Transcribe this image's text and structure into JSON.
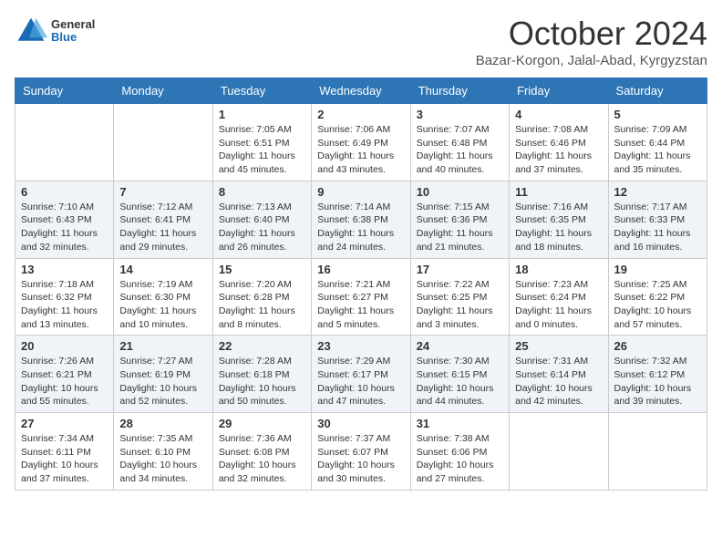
{
  "header": {
    "logo": {
      "general": "General",
      "blue": "Blue"
    },
    "title": "October 2024",
    "subtitle": "Bazar-Korgon, Jalal-Abad, Kyrgyzstan"
  },
  "weekdays": [
    "Sunday",
    "Monday",
    "Tuesday",
    "Wednesday",
    "Thursday",
    "Friday",
    "Saturday"
  ],
  "weeks": [
    [
      {
        "day": "",
        "info": ""
      },
      {
        "day": "",
        "info": ""
      },
      {
        "day": "1",
        "info": "Sunrise: 7:05 AM\nSunset: 6:51 PM\nDaylight: 11 hours and 45 minutes."
      },
      {
        "day": "2",
        "info": "Sunrise: 7:06 AM\nSunset: 6:49 PM\nDaylight: 11 hours and 43 minutes."
      },
      {
        "day": "3",
        "info": "Sunrise: 7:07 AM\nSunset: 6:48 PM\nDaylight: 11 hours and 40 minutes."
      },
      {
        "day": "4",
        "info": "Sunrise: 7:08 AM\nSunset: 6:46 PM\nDaylight: 11 hours and 37 minutes."
      },
      {
        "day": "5",
        "info": "Sunrise: 7:09 AM\nSunset: 6:44 PM\nDaylight: 11 hours and 35 minutes."
      }
    ],
    [
      {
        "day": "6",
        "info": "Sunrise: 7:10 AM\nSunset: 6:43 PM\nDaylight: 11 hours and 32 minutes."
      },
      {
        "day": "7",
        "info": "Sunrise: 7:12 AM\nSunset: 6:41 PM\nDaylight: 11 hours and 29 minutes."
      },
      {
        "day": "8",
        "info": "Sunrise: 7:13 AM\nSunset: 6:40 PM\nDaylight: 11 hours and 26 minutes."
      },
      {
        "day": "9",
        "info": "Sunrise: 7:14 AM\nSunset: 6:38 PM\nDaylight: 11 hours and 24 minutes."
      },
      {
        "day": "10",
        "info": "Sunrise: 7:15 AM\nSunset: 6:36 PM\nDaylight: 11 hours and 21 minutes."
      },
      {
        "day": "11",
        "info": "Sunrise: 7:16 AM\nSunset: 6:35 PM\nDaylight: 11 hours and 18 minutes."
      },
      {
        "day": "12",
        "info": "Sunrise: 7:17 AM\nSunset: 6:33 PM\nDaylight: 11 hours and 16 minutes."
      }
    ],
    [
      {
        "day": "13",
        "info": "Sunrise: 7:18 AM\nSunset: 6:32 PM\nDaylight: 11 hours and 13 minutes."
      },
      {
        "day": "14",
        "info": "Sunrise: 7:19 AM\nSunset: 6:30 PM\nDaylight: 11 hours and 10 minutes."
      },
      {
        "day": "15",
        "info": "Sunrise: 7:20 AM\nSunset: 6:28 PM\nDaylight: 11 hours and 8 minutes."
      },
      {
        "day": "16",
        "info": "Sunrise: 7:21 AM\nSunset: 6:27 PM\nDaylight: 11 hours and 5 minutes."
      },
      {
        "day": "17",
        "info": "Sunrise: 7:22 AM\nSunset: 6:25 PM\nDaylight: 11 hours and 3 minutes."
      },
      {
        "day": "18",
        "info": "Sunrise: 7:23 AM\nSunset: 6:24 PM\nDaylight: 11 hours and 0 minutes."
      },
      {
        "day": "19",
        "info": "Sunrise: 7:25 AM\nSunset: 6:22 PM\nDaylight: 10 hours and 57 minutes."
      }
    ],
    [
      {
        "day": "20",
        "info": "Sunrise: 7:26 AM\nSunset: 6:21 PM\nDaylight: 10 hours and 55 minutes."
      },
      {
        "day": "21",
        "info": "Sunrise: 7:27 AM\nSunset: 6:19 PM\nDaylight: 10 hours and 52 minutes."
      },
      {
        "day": "22",
        "info": "Sunrise: 7:28 AM\nSunset: 6:18 PM\nDaylight: 10 hours and 50 minutes."
      },
      {
        "day": "23",
        "info": "Sunrise: 7:29 AM\nSunset: 6:17 PM\nDaylight: 10 hours and 47 minutes."
      },
      {
        "day": "24",
        "info": "Sunrise: 7:30 AM\nSunset: 6:15 PM\nDaylight: 10 hours and 44 minutes."
      },
      {
        "day": "25",
        "info": "Sunrise: 7:31 AM\nSunset: 6:14 PM\nDaylight: 10 hours and 42 minutes."
      },
      {
        "day": "26",
        "info": "Sunrise: 7:32 AM\nSunset: 6:12 PM\nDaylight: 10 hours and 39 minutes."
      }
    ],
    [
      {
        "day": "27",
        "info": "Sunrise: 7:34 AM\nSunset: 6:11 PM\nDaylight: 10 hours and 37 minutes."
      },
      {
        "day": "28",
        "info": "Sunrise: 7:35 AM\nSunset: 6:10 PM\nDaylight: 10 hours and 34 minutes."
      },
      {
        "day": "29",
        "info": "Sunrise: 7:36 AM\nSunset: 6:08 PM\nDaylight: 10 hours and 32 minutes."
      },
      {
        "day": "30",
        "info": "Sunrise: 7:37 AM\nSunset: 6:07 PM\nDaylight: 10 hours and 30 minutes."
      },
      {
        "day": "31",
        "info": "Sunrise: 7:38 AM\nSunset: 6:06 PM\nDaylight: 10 hours and 27 minutes."
      },
      {
        "day": "",
        "info": ""
      },
      {
        "day": "",
        "info": ""
      }
    ]
  ]
}
